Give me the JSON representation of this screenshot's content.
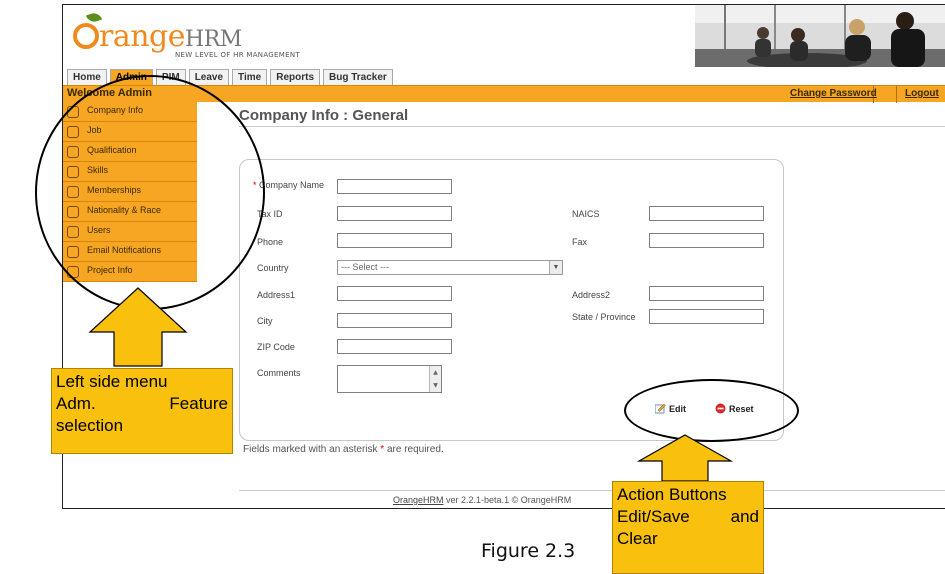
{
  "app": {
    "logo_brand": "OrangeHRM",
    "logo_brand_main": "range",
    "logo_brand_suffix": "HRM",
    "logo_tagline": "NEW LEVEL OF HR MANAGEMENT"
  },
  "tabs": [
    {
      "label": "Home",
      "active": false
    },
    {
      "label": "Admin",
      "active": true
    },
    {
      "label": "PIM",
      "active": false
    },
    {
      "label": "Leave",
      "active": false
    },
    {
      "label": "Time",
      "active": false
    },
    {
      "label": "Reports",
      "active": false
    },
    {
      "label": "Bug Tracker",
      "active": false
    }
  ],
  "topbar": {
    "welcome": "Welcome Admin",
    "change_password": "Change Password",
    "logout": "Logout"
  },
  "sidebar": {
    "items": [
      {
        "label": "Company Info",
        "icon": "magnifier-icon"
      },
      {
        "label": "Job",
        "icon": "briefcase-icon"
      },
      {
        "label": "Qualification",
        "icon": "folder-icon"
      },
      {
        "label": "Skills",
        "icon": "people-icon"
      },
      {
        "label": "Memberships",
        "icon": "card-icon"
      },
      {
        "label": "Nationality & Race",
        "icon": "group-icon"
      },
      {
        "label": "Users",
        "icon": "user-icon"
      },
      {
        "label": "Email Notifications",
        "icon": "envelope-icon"
      },
      {
        "label": "Project Info",
        "icon": "project-icon"
      }
    ]
  },
  "page": {
    "title": "Company Info : General"
  },
  "form": {
    "company_name": {
      "label": "Company Name",
      "value": ""
    },
    "tax_id": {
      "label": "Tax ID",
      "value": ""
    },
    "naics": {
      "label": "NAICS",
      "value": ""
    },
    "phone": {
      "label": "Phone",
      "value": ""
    },
    "fax": {
      "label": "Fax",
      "value": ""
    },
    "country": {
      "label": "Country",
      "selected": "--- Select ---"
    },
    "address1": {
      "label": "Address1",
      "value": ""
    },
    "address2": {
      "label": "Address2",
      "value": ""
    },
    "city": {
      "label": "City",
      "value": ""
    },
    "state": {
      "label": "State / Province",
      "value": ""
    },
    "zip": {
      "label": "ZIP Code",
      "value": ""
    },
    "comments": {
      "label": "Comments",
      "value": ""
    },
    "required_marker": "*"
  },
  "buttons": {
    "edit": "Edit",
    "reset": "Reset"
  },
  "note": {
    "before": "Fields marked with an asterisk",
    "marker": "*",
    "after": "are required."
  },
  "footer": {
    "link": "OrangeHRM",
    "text": "ver 2.2.1-beta.1 © OrangeHRM"
  },
  "annotations": {
    "left_callout": {
      "line1": "Left side menu",
      "line2a": "Adm.",
      "line2b": "Feature",
      "line3": "selection"
    },
    "right_callout": {
      "line1": "Action Buttons",
      "line2a": "Edit/Save",
      "line2b": "and",
      "line3": "Clear"
    },
    "figure": "Figure 2.3"
  },
  "colors": {
    "orange": "#f6a623",
    "callout": "#f9c10e",
    "logo_orange": "#f08a1d"
  }
}
